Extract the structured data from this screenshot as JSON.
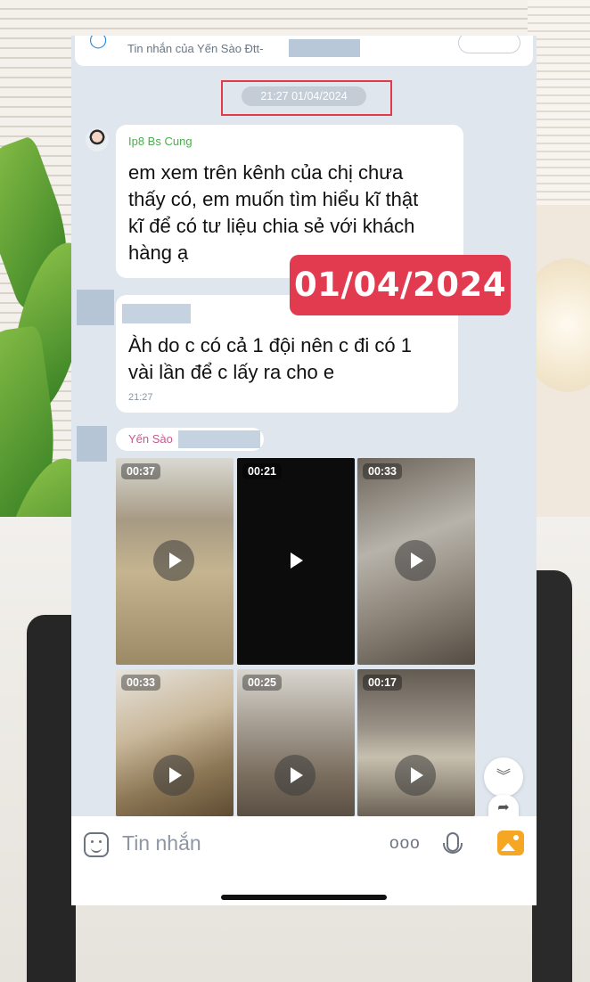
{
  "pinned": {
    "text": "Tin nhắn của Yến Sào Đtt-"
  },
  "date_separator": "21:27 01/04/2024",
  "messages": [
    {
      "sender": "Ip8 Bs Cung",
      "text_lines": [
        "em xem trên kênh của chị chưa",
        "thấy có, em muốn tìm hiểu kĩ thật",
        "kĩ để có tư liệu chia sẻ với khách",
        "hàng ạ"
      ]
    },
    {
      "sender": "",
      "text_lines": [
        "Àh do c có cả  1 đội nên c đi có 1",
        "vài lần để  c lấy ra cho e"
      ],
      "time": "21:27"
    }
  ],
  "overlay_stamp": "01/04/2024",
  "video_sender": "Yến Sào",
  "videos": [
    {
      "duration": "00:37"
    },
    {
      "duration": "00:21"
    },
    {
      "duration": "00:33"
    },
    {
      "duration": "00:33"
    },
    {
      "duration": "00:25"
    },
    {
      "duration": "00:17"
    }
  ],
  "composer": {
    "placeholder": "Tin nhắn",
    "more": "ooo"
  },
  "colors": {
    "accent_red": "#e23a4f",
    "sender_green": "#4cae4f",
    "sender_pink": "#c25a8e"
  }
}
